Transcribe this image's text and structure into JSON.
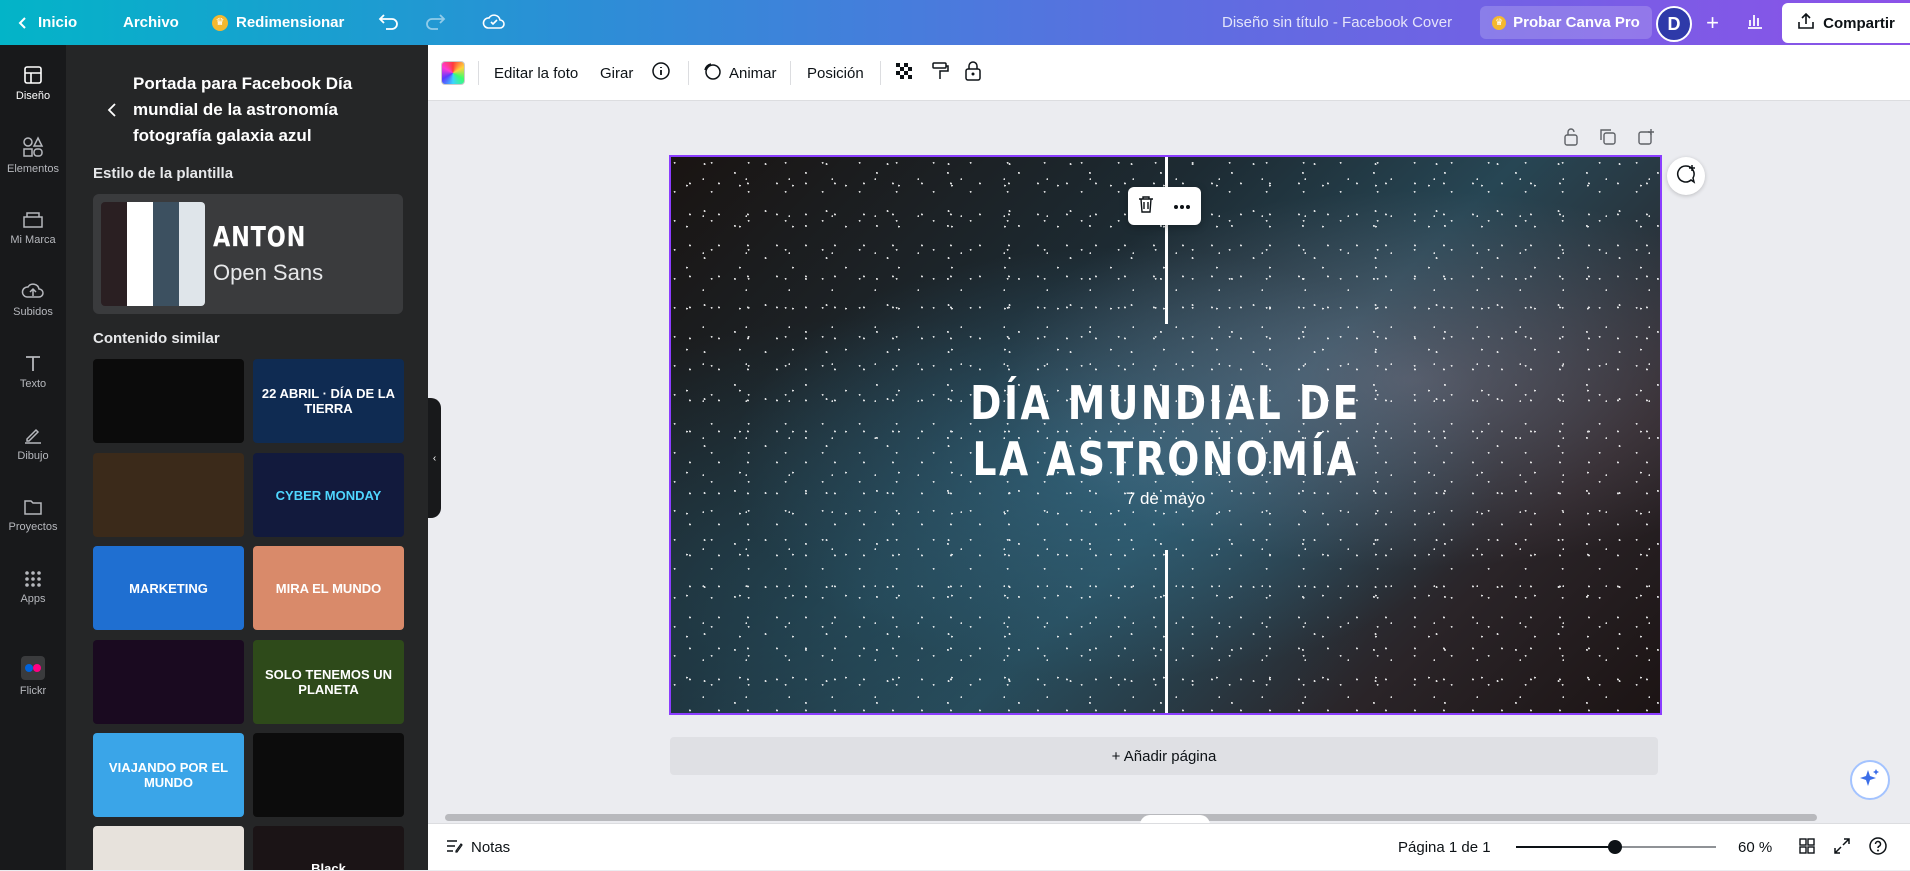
{
  "topbar": {
    "back_label": "Inicio",
    "file_label": "Archivo",
    "resize_label": "Redimensionar",
    "doc_title": "Diseño sin título - Facebook Cover",
    "pro_label": "Probar Canva Pro",
    "avatar_initial": "D",
    "share_label": "Compartir"
  },
  "rail": {
    "items": [
      {
        "label": "Diseño",
        "icon": "layout-icon"
      },
      {
        "label": "Elementos",
        "icon": "shapes-icon"
      },
      {
        "label": "Mi Marca",
        "icon": "brand-icon"
      },
      {
        "label": "Subidos",
        "icon": "upload-cloud-icon"
      },
      {
        "label": "Texto",
        "icon": "text-icon"
      },
      {
        "label": "Dibujo",
        "icon": "pen-icon"
      },
      {
        "label": "Proyectos",
        "icon": "folder-icon"
      },
      {
        "label": "Apps",
        "icon": "grid-icon"
      },
      {
        "label": "Flickr",
        "icon": "flickr-icon"
      }
    ]
  },
  "panel": {
    "title": "Portada para Facebook Día mundial de la astronomía fotografía galaxia azul",
    "style_section": "Estilo de la plantilla",
    "font_heading": "ANTON",
    "font_body": "Open Sans",
    "palette": [
      "#2a1f22",
      "#ffffff",
      "#3c5060",
      "#dfe5ea"
    ],
    "similar_section": "Contenido similar",
    "thumbs": [
      {
        "text": "",
        "bg": "#0b0b0b",
        "fg": "#ffffff"
      },
      {
        "text": "22 ABRIL · DÍA DE LA TIERRA",
        "bg": "#0f2b52",
        "fg": "#ffffff"
      },
      {
        "text": "",
        "bg": "#3b2a1a",
        "fg": "#ffffff"
      },
      {
        "text": "CYBER MONDAY",
        "bg": "#121a3d",
        "fg": "#4fd6ff"
      },
      {
        "text": "MARKETING",
        "bg": "#1f6fd1",
        "fg": "#ffffff"
      },
      {
        "text": "MIRA EL MUNDO",
        "bg": "#d98a6a",
        "fg": "#ffffff"
      },
      {
        "text": "",
        "bg": "#1a0a20",
        "fg": "#e63cf0"
      },
      {
        "text": "SOLO TENEMOS UN PLANETA",
        "bg": "#2e4a1a",
        "fg": "#ffffff"
      },
      {
        "text": "VIAJANDO POR EL MUNDO",
        "bg": "#3aa5e8",
        "fg": "#ffffff"
      },
      {
        "text": "",
        "bg": "#0c0c0c",
        "fg": "#ffffff"
      },
      {
        "text": "",
        "bg": "#e7e2dc",
        "fg": "#333333"
      },
      {
        "text": "Black",
        "bg": "#1b1416",
        "fg": "#ffffff"
      }
    ]
  },
  "context_toolbar": {
    "edit_photo": "Editar la foto",
    "rotate": "Girar",
    "animate": "Animar",
    "position": "Posición"
  },
  "canvas": {
    "headline_line1": "DÍA MUNDIAL DE",
    "headline_line2": "LA ASTRONOMÍA",
    "subline": "7 de mayo",
    "add_page": "+ Añadir página"
  },
  "bottombar": {
    "notes_label": "Notas",
    "page_indicator": "Página 1 de 1",
    "zoom": "60 %",
    "zoom_fraction": 0.6
  },
  "colors": {
    "accent": "#8b3dff",
    "rail_bg": "#18191b",
    "panel_bg": "#252627"
  }
}
